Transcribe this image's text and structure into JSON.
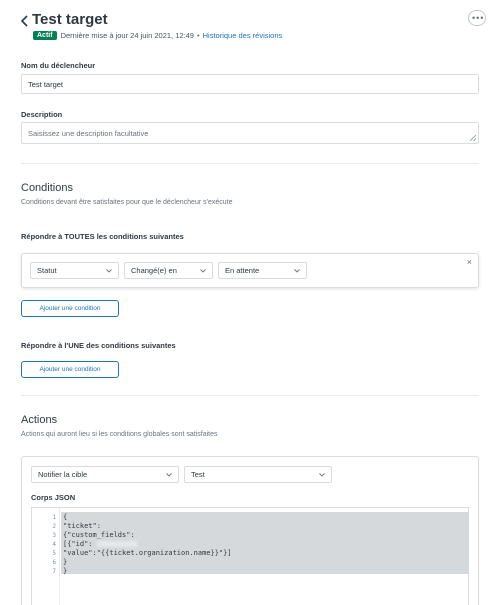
{
  "header": {
    "title": "Test target",
    "status_badge": "Actif",
    "last_updated": "Dernière mise à jour 24 juin 2021, 12:49",
    "separator": "•",
    "history_link": "Historique des révisions"
  },
  "trigger_name": {
    "label": "Nom du déclencheur",
    "value": "Test target"
  },
  "description": {
    "label": "Description",
    "placeholder": "Saisissez une description facultative"
  },
  "conditions": {
    "title": "Conditions",
    "subtitle": "Conditions devant être satisfaites pour que le déclencheur s'exécute",
    "all_label": "Répondre à TOUTES les conditions suivantes",
    "row": {
      "field": "Statut",
      "operator": "Changé(e) en",
      "value": "En attente"
    },
    "close_symbol": "×",
    "add_button": "Ajouter une condition",
    "any_label": "Répondre à l'UNE des conditions suivantes",
    "add_button_any": "Ajouter une condition"
  },
  "actions": {
    "title": "Actions",
    "subtitle": "Actions qui auront lieu si les conditions globales sont satisfaites",
    "action_select": "Notifier la cible",
    "target_select": "Test",
    "json_label": "Corps JSON",
    "code_lines": [
      {
        "num": "1",
        "text": "{"
      },
      {
        "num": "2",
        "text": "\"ticket\":"
      },
      {
        "num": "3",
        "text": "{\"custom_fields\":"
      },
      {
        "num": "4",
        "text": "[{\"id\":"
      },
      {
        "num": "5",
        "text": "\"value\":\"{{ticket.organization.name}}\"}]"
      },
      {
        "num": "6",
        "text": "}"
      },
      {
        "num": "7",
        "text": "}"
      }
    ]
  },
  "colors": {
    "accent": "#1f73b7",
    "badge": "#038153"
  }
}
